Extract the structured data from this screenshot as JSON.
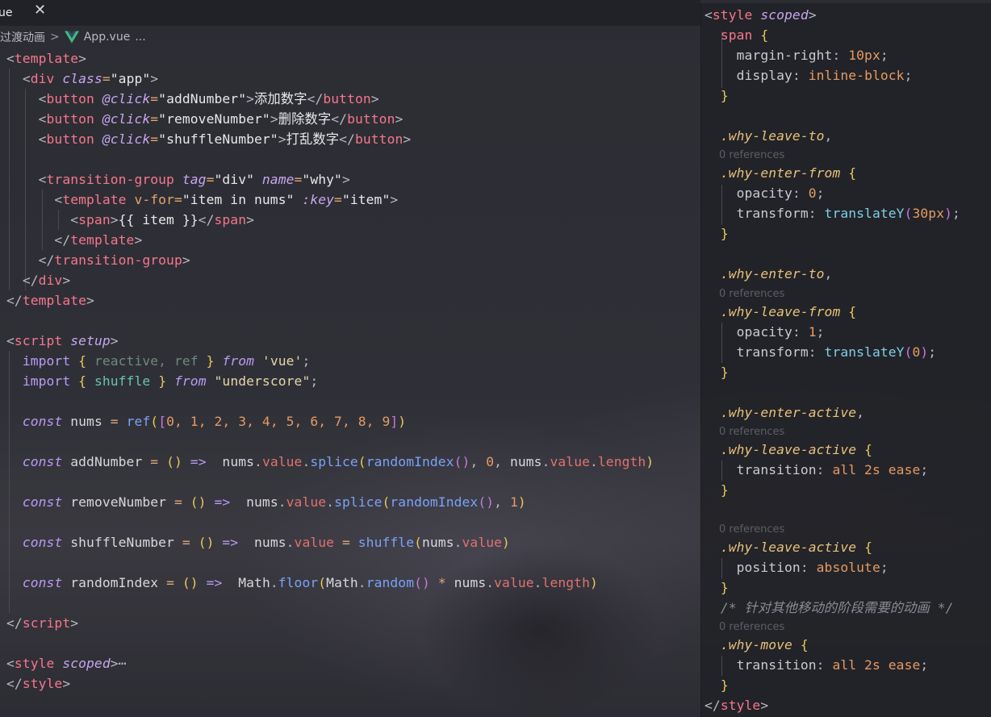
{
  "tab": {
    "title": "ue",
    "close_glyph": "✕"
  },
  "breadcrumb": {
    "folder": "过渡动画",
    "separator": ">",
    "file": "App.vue",
    "more": "..."
  },
  "left_code": {
    "template_open": "<template>",
    "div_open": [
      "<",
      "div",
      " ",
      "class",
      "=",
      "\"app\"",
      ">"
    ],
    "btn1": {
      "label": "添加数字",
      "handler": "\"addNumber\""
    },
    "btn2": {
      "label": "删除数字",
      "handler": "\"removeNumber\""
    },
    "btn3": {
      "label": "打乱数字",
      "handler": "\"shuffleNumber\""
    },
    "tg_tag": "\"div\"",
    "tg_name": "\"why\"",
    "vfor": "\"item in nums\"",
    "key": "\"item\"",
    "span_content": "{{ item }}",
    "import1": {
      "items": "reactive, ref",
      "source": "'vue'"
    },
    "import2": {
      "items": "shuffle",
      "source": "\"underscore\""
    },
    "nums_values": "0, 1, 2, 3, 4, 5, 6, 7, 8, 9",
    "style_collapsed": "⋯"
  },
  "right_code": {
    "references_label": "0 references",
    "comment": "/* 针对其他移动的阶段需要的动画 */"
  }
}
